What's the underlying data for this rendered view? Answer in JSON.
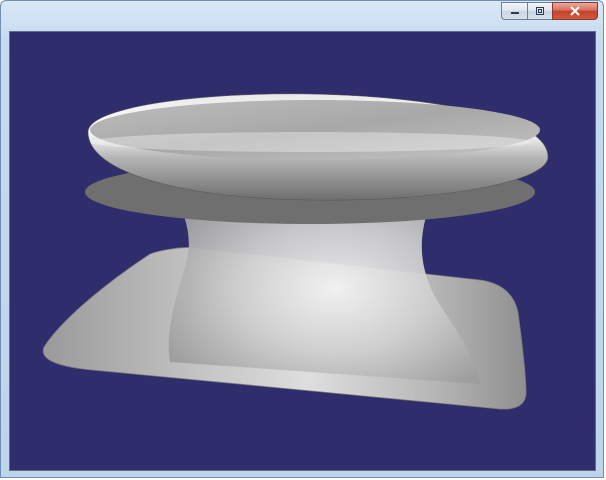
{
  "window": {
    "title": "",
    "controls": {
      "minimize_icon": "minimize-icon",
      "maximize_icon": "maximize-icon",
      "close_icon": "close-icon"
    }
  },
  "viewport": {
    "background_color": "#2f2d6b",
    "model_color": "#c8c8c8",
    "model_icon": "3d-surface-of-revolution"
  }
}
